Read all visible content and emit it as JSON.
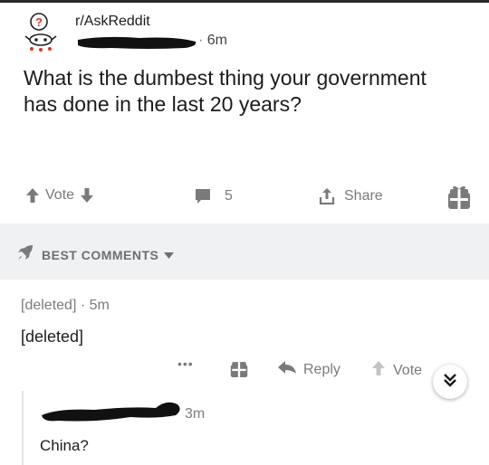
{
  "post": {
    "subreddit": "r/AskReddit",
    "separator": "·",
    "time": "6m",
    "title": "What is the dumbest thing your government has done in the last 20 years?"
  },
  "actions": {
    "vote_label": "Vote",
    "comment_count": "5",
    "share_label": "Share"
  },
  "comments_section": {
    "sort_label": "BEST COMMENTS"
  },
  "comments": [
    {
      "author": "[deleted]",
      "separator": "·",
      "time": "5m",
      "body": "[deleted]",
      "more_label": "•••",
      "reply_label": "Reply",
      "vote_label": "Vote"
    },
    {
      "time": "3m",
      "body": "China?"
    }
  ],
  "icons": {
    "subreddit": "askreddit-snoo-icon",
    "upvote": "arrow-up-icon",
    "downvote": "arrow-down-icon",
    "comment": "comment-bubble-icon",
    "share": "share-icon",
    "award": "gift-award-icon",
    "rocket": "rocket-icon",
    "dropdown": "caret-down-icon",
    "reply": "reply-arrow-icon",
    "collapse": "double-chevron-down-icon"
  },
  "colors": {
    "text": "#1c1c1c",
    "muted": "#7a7a7a",
    "section_bg": "#f0f1f3"
  }
}
